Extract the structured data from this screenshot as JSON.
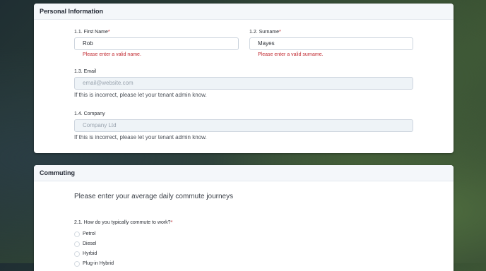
{
  "personal": {
    "title": "Personal Information",
    "first_name": {
      "label": "1.1. First Name",
      "required_mark": "*",
      "value": "Rob",
      "error": "Please enter a valid name."
    },
    "surname": {
      "label": "1.2. Surname",
      "required_mark": "*",
      "value": "Mayes",
      "error": "Please enter a valid surname."
    },
    "email": {
      "label": "1.3. Email",
      "placeholder": "email@website.com",
      "help": "If this is incorrect, please let your tenant admin know."
    },
    "company": {
      "label": "1.4. Company",
      "placeholder": "Company Ltd",
      "help": "If this is incorrect, please let your tenant admin know."
    }
  },
  "commuting": {
    "title": "Commuting",
    "subtitle": "Please enter your average daily commute journeys",
    "question": {
      "label": "2.1. How do you typically commute to work?",
      "required_mark": "*"
    },
    "options": [
      "Petrol",
      "Diesel",
      "Hyrbid",
      "Plug-in Hybrid"
    ]
  }
}
